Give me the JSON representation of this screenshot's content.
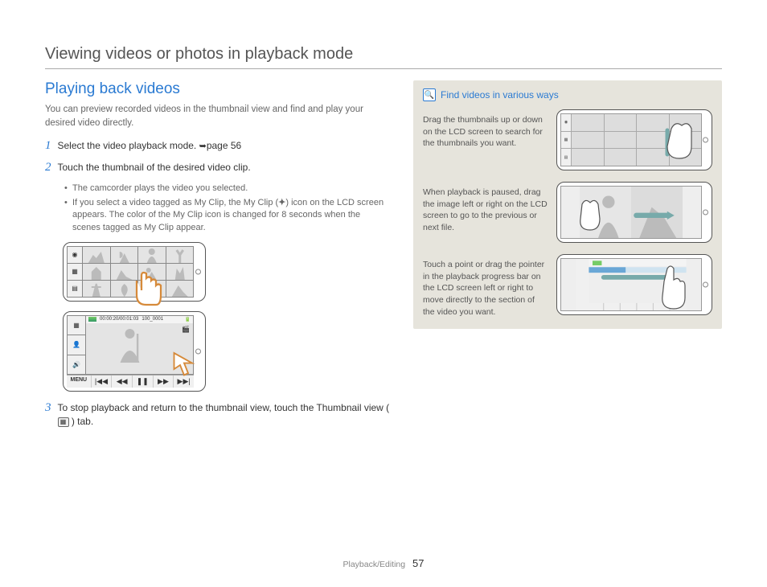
{
  "header": {
    "title": "Viewing videos or photos in playback mode"
  },
  "left": {
    "heading": "Playing back videos",
    "intro": "You can preview recorded videos in the thumbnail view and find and play your desired video directly.",
    "step1": {
      "num": "1",
      "text_a": "Select the video playback mode. ",
      "text_b": "page 56"
    },
    "step2": {
      "num": "2",
      "text": "Touch the thumbnail of the desired video clip."
    },
    "bullets": {
      "b1": "The camcorder plays the video you selected.",
      "b2_a": "If you select a video tagged as My Clip, the My Clip (",
      "b2_b": ") icon on the LCD screen appears. The color of the My Clip icon is changed for 8 seconds when the scenes tagged as My Clip appear."
    },
    "playback_meta": {
      "time": "00:00:20/00:01:03",
      "file": "100_0001"
    },
    "controls": {
      "menu": "MENU",
      "prev": "|◀◀",
      "rew": "◀◀",
      "pause": "❚❚",
      "fwd": "▶▶",
      "next": "▶▶|"
    },
    "step3": {
      "num": "3",
      "text_a": "To stop playback and return to the thumbnail view, touch the Thumbnail view (",
      "text_b": ") tab."
    }
  },
  "right": {
    "tip_title": "Find videos in various ways",
    "tip1": "Drag the thumbnails up or down on the LCD screen to search for the thumbnails you want.",
    "tip2": "When playback is paused, drag the image left or right on the LCD screen to go to the previous or next file.",
    "tip3": "Touch a point or drag the pointer in the playback progress bar on the LCD screen left or right to move directly to the section of the video you want."
  },
  "footer": {
    "section": "Playback/Editing",
    "page": "57"
  }
}
